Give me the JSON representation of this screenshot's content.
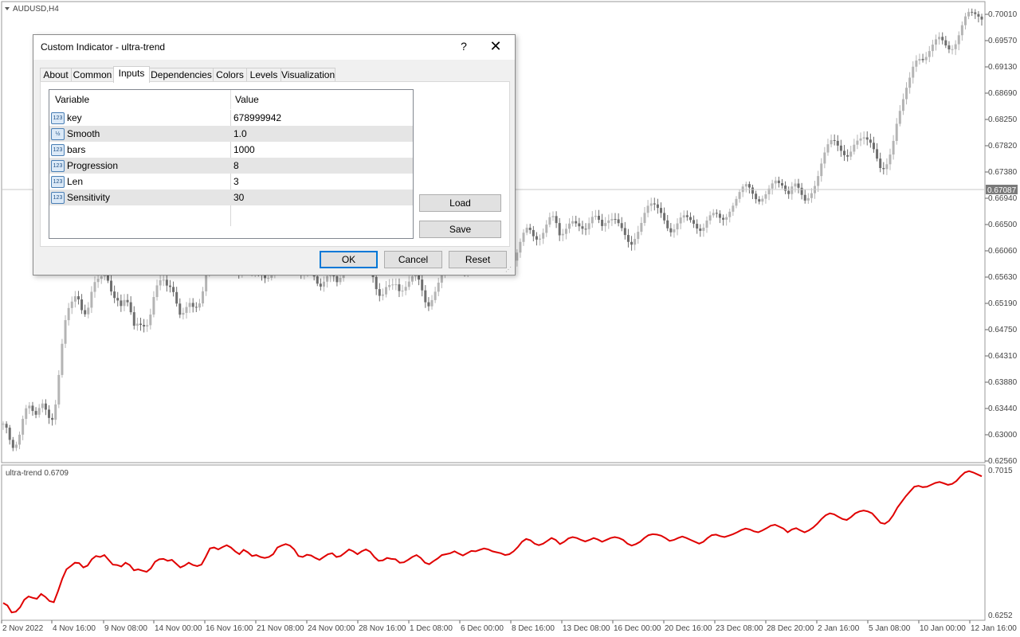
{
  "chart": {
    "symbol_label": "AUDUSD,H4",
    "current_price": "0.67087",
    "price_ticks": [
      "0.70010",
      "0.69570",
      "0.69130",
      "0.68690",
      "0.68250",
      "0.67820",
      "0.67380",
      "0.66940",
      "0.66500",
      "0.66060",
      "0.65630",
      "0.65190",
      "0.64750",
      "0.64310",
      "0.63880",
      "0.63440",
      "0.63000",
      "0.62560"
    ],
    "indicator_label": "ultra-trend 0.6709",
    "indicator_ticks": [
      "0.7015",
      "0.6252"
    ],
    "time_ticks": [
      "2 Nov 2022",
      "4 Nov 16:00",
      "9 Nov 08:00",
      "14 Nov 00:00",
      "16 Nov 16:00",
      "21 Nov 08:00",
      "24 Nov 00:00",
      "28 Nov 16:00",
      "1 Dec 08:00",
      "6 Dec 00:00",
      "8 Dec 16:00",
      "13 Dec 08:00",
      "16 Dec 00:00",
      "20 Dec 16:00",
      "23 Dec 08:00",
      "28 Dec 20:00",
      "2 Jan 16:00",
      "5 Jan 08:00",
      "10 Jan 00:00",
      "12 Jan 16:00"
    ],
    "colors": {
      "bull_candle": "#b4b4b4",
      "bear_candle": "#6e6e6e",
      "indicator_line": "#e00000",
      "grid": "#c8c8c8"
    },
    "indicator_line": [
      0.6318,
      0.6305,
      0.6268,
      0.6272,
      0.6295,
      0.6335,
      0.6352,
      0.6345,
      0.634,
      0.6365,
      0.635,
      0.6328,
      0.6322,
      0.638,
      0.6445,
      0.6495,
      0.6512,
      0.653,
      0.6528,
      0.6505,
      0.6515,
      0.6548,
      0.6565,
      0.656,
      0.657,
      0.6545,
      0.652,
      0.6518,
      0.651,
      0.653,
      0.6518,
      0.649,
      0.6495,
      0.6488,
      0.6482,
      0.65,
      0.6535,
      0.6548,
      0.655,
      0.654,
      0.6545,
      0.6525,
      0.6505,
      0.6515,
      0.653,
      0.6518,
      0.6512,
      0.652,
      0.656,
      0.6605,
      0.661,
      0.66,
      0.6612,
      0.6622,
      0.661,
      0.659,
      0.6575,
      0.6598,
      0.6585,
      0.6565,
      0.657,
      0.656,
      0.6555,
      0.656,
      0.6575,
      0.661,
      0.662,
      0.6628,
      0.662,
      0.66,
      0.6565,
      0.656,
      0.6572,
      0.6568,
      0.6555,
      0.6545,
      0.656,
      0.6575,
      0.658,
      0.656,
      0.6565,
      0.6582,
      0.66,
      0.659,
      0.6575,
      0.659,
      0.66,
      0.6588,
      0.656,
      0.654,
      0.6542,
      0.6555,
      0.655,
      0.6548,
      0.653,
      0.6532,
      0.6545,
      0.656,
      0.657,
      0.6555,
      0.653,
      0.6522,
      0.6538,
      0.6552,
      0.657,
      0.6575,
      0.658,
      0.659,
      0.6578,
      0.6568,
      0.658,
      0.6592,
      0.659,
      0.6598,
      0.6605,
      0.66,
      0.659,
      0.6585,
      0.658,
      0.657,
      0.6575,
      0.659,
      0.6612,
      0.664,
      0.6655,
      0.6648,
      0.663,
      0.6622,
      0.663,
      0.6645,
      0.666,
      0.665,
      0.6628,
      0.664,
      0.6658,
      0.6665,
      0.666,
      0.665,
      0.6642,
      0.665,
      0.666,
      0.6652,
      0.664,
      0.665,
      0.666,
      0.6665,
      0.666,
      0.665,
      0.663,
      0.662,
      0.6628,
      0.664,
      0.666,
      0.6675,
      0.668,
      0.6678,
      0.6672,
      0.666,
      0.6645,
      0.665,
      0.666,
      0.6668,
      0.666,
      0.665,
      0.664,
      0.663,
      0.664,
      0.666,
      0.6675,
      0.6678,
      0.667,
      0.6665,
      0.6672,
      0.668,
      0.669,
      0.6702,
      0.671,
      0.6705,
      0.6695,
      0.669,
      0.67,
      0.6712,
      0.6725,
      0.673,
      0.672,
      0.671,
      0.669,
      0.6705,
      0.6712,
      0.67,
      0.669,
      0.67,
      0.6715,
      0.6735,
      0.676,
      0.678,
      0.679,
      0.6785,
      0.6772,
      0.676,
      0.6755,
      0.677,
      0.679,
      0.68,
      0.6805,
      0.68,
      0.679,
      0.6765,
      0.674,
      0.6735,
      0.675,
      0.678,
      0.682,
      0.685,
      0.688,
      0.6905,
      0.693,
      0.6935,
      0.6928,
      0.693,
      0.694,
      0.695,
      0.6955,
      0.6948,
      0.694,
      0.6945,
      0.696,
      0.6985,
      0.7005,
      0.7012,
      0.7005,
      0.6995,
      0.6985
    ]
  },
  "dialog": {
    "title": "Custom Indicator - ultra-trend",
    "help_glyph": "?",
    "close_glyph": "✕",
    "tabs": [
      "About",
      "Common",
      "Inputs",
      "Dependencies",
      "Colors",
      "Levels",
      "Visualization"
    ],
    "active_tab": "Inputs",
    "grid_headers": {
      "variable": "Variable",
      "value": "Value"
    },
    "inputs": [
      {
        "name": "key",
        "value": "678999942",
        "icon": "int-icon",
        "icon_text": "123"
      },
      {
        "name": "Smooth",
        "value": "1.0",
        "icon": "double-icon",
        "icon_text": "½"
      },
      {
        "name": "bars",
        "value": "1000",
        "icon": "int-icon",
        "icon_text": "123"
      },
      {
        "name": "Progression",
        "value": "8",
        "icon": "int-icon",
        "icon_text": "123"
      },
      {
        "name": "Len",
        "value": "3",
        "icon": "int-icon",
        "icon_text": "123"
      },
      {
        "name": "Sensitivity",
        "value": "30",
        "icon": "int-icon",
        "icon_text": "123"
      }
    ],
    "buttons": {
      "load": "Load",
      "save": "Save",
      "ok": "OK",
      "cancel": "Cancel",
      "reset": "Reset"
    }
  }
}
